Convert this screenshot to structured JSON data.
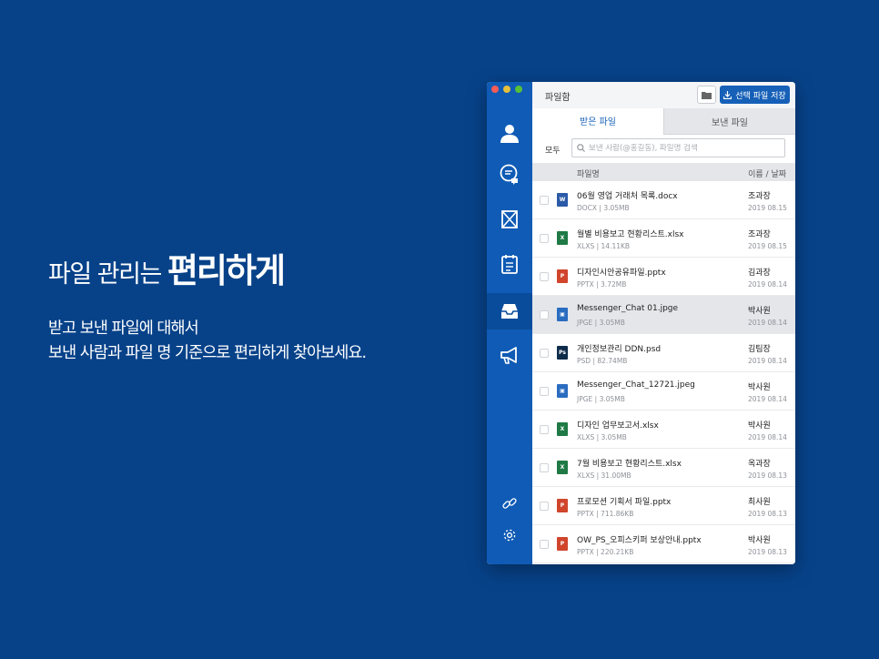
{
  "promo": {
    "title_regular": "파일 관리는 ",
    "title_bold": "편리하게",
    "desc_line1": "받고 보낸 파일에 대해서",
    "desc_line2": "보낸 사람과 파일 명 기준으로 편리하게 찾아보세요."
  },
  "window": {
    "title": "파일함",
    "save_button": "선택 파일 저장",
    "tabs": [
      "받은 파일",
      "보낸 파일"
    ],
    "filter_label": "모두",
    "search_placeholder": "보낸 사람(@홍길동), 파일명 검색",
    "header_name": "파일명",
    "header_meta": "이름 / 날짜"
  },
  "sidebar_icons": [
    "profile-icon",
    "chat-icon",
    "message-icon",
    "calendar-icon",
    "inbox-icon",
    "megaphone-icon",
    "link-icon",
    "settings-icon"
  ],
  "colors": {
    "background": "#074289",
    "sidebar": "#0f5bb5",
    "accent": "#1660b8",
    "docx": "#2a5aa8",
    "xlsx": "#1f7a45",
    "pptx": "#d0452c",
    "jpeg": "#2a6cc0",
    "psd": "#0e2b4a"
  },
  "files": [
    {
      "name": "06월 영업 거래처 목록.docx",
      "meta": "DOCX | 3.05MB",
      "sender": "조과장",
      "date": "2019 08.15",
      "type": "docx",
      "selected": false
    },
    {
      "name": "월별 비용보고 현황리스트.xlsx",
      "meta": "XLXS | 14.11KB",
      "sender": "조과장",
      "date": "2019 08.15",
      "type": "xlsx",
      "selected": false
    },
    {
      "name": "디자인시안공유파일.pptx",
      "meta": "PPTX | 3.72MB",
      "sender": "김과장",
      "date": "2019 08.14",
      "type": "pptx",
      "selected": false
    },
    {
      "name": "Messenger_Chat 01.jpge",
      "meta": "JPGE | 3.05MB",
      "sender": "박사원",
      "date": "2019 08.14",
      "type": "jpeg",
      "selected": true
    },
    {
      "name": "개인정보관리 DDN.psd",
      "meta": "PSD | 82.74MB",
      "sender": "김팀장",
      "date": "2019 08.14",
      "type": "psd",
      "selected": false
    },
    {
      "name": "Messenger_Chat_12721.jpeg",
      "meta": "JPGE | 3.05MB",
      "sender": "박사원",
      "date": "2019 08.14",
      "type": "jpeg",
      "selected": false
    },
    {
      "name": "디자인 업무보고서.xlsx",
      "meta": "XLXS | 3.05MB",
      "sender": "박사원",
      "date": "2019 08.14",
      "type": "xlsx",
      "selected": false
    },
    {
      "name": "7월 비용보고 현황리스트.xlsx",
      "meta": "XLXS | 31.00MB",
      "sender": "옥과장",
      "date": "2019 08.13",
      "type": "xlsx",
      "selected": false
    },
    {
      "name": "프로모션 기획서 파일.pptx",
      "meta": "PPTX | 711.86KB",
      "sender": "최사원",
      "date": "2019 08.13",
      "type": "pptx",
      "selected": false
    },
    {
      "name": "OW_PS_오피스키퍼 보상안내.pptx",
      "meta": "PPTX | 220.21KB",
      "sender": "박사원",
      "date": "2019 08.13",
      "type": "pptx",
      "selected": false
    }
  ]
}
